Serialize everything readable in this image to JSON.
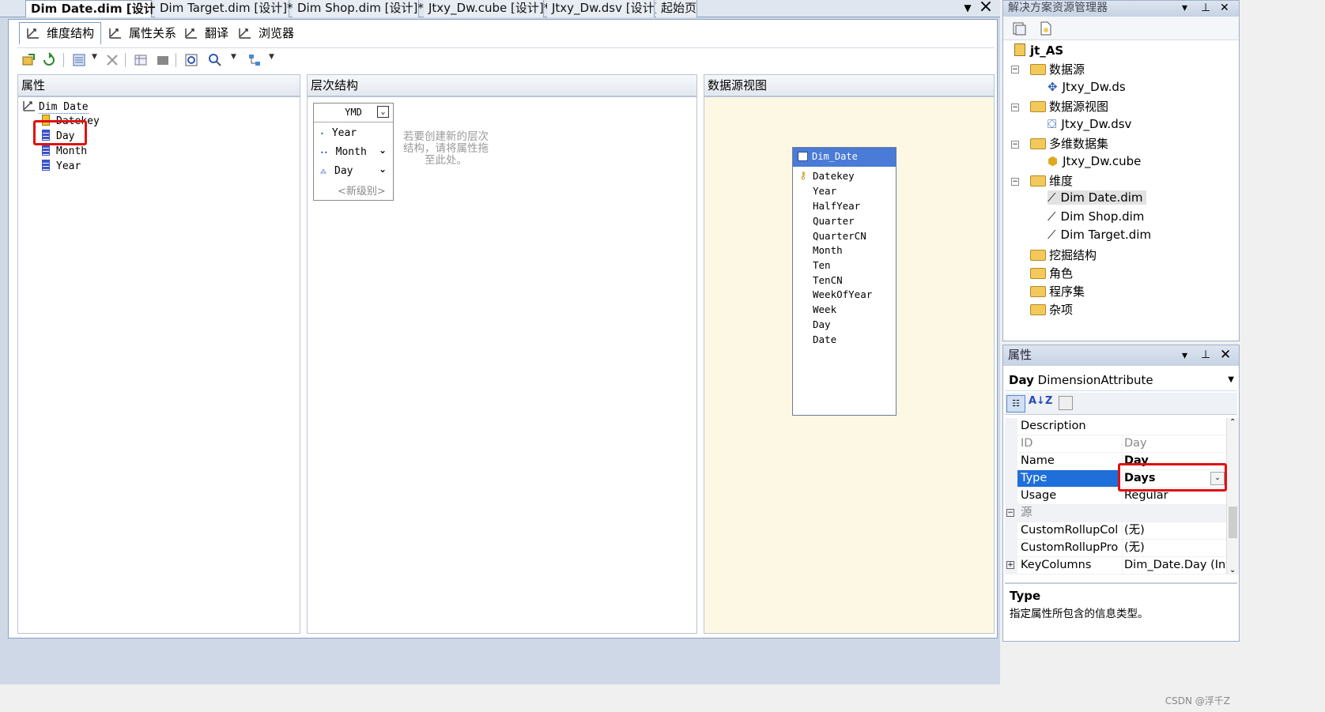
{
  "doc_tabs": [
    {
      "label": "Dim Date.dim [设计]*",
      "active": true
    },
    {
      "label": "Dim Target.dim [设计]*",
      "active": false
    },
    {
      "label": "Dim Shop.dim [设计]*",
      "active": false
    },
    {
      "label": "Jtxy_Dw.cube [设计]*",
      "active": false
    },
    {
      "label": "Jtxy_Dw.dsv [设计]",
      "active": false
    },
    {
      "label": "起始页",
      "active": false
    }
  ],
  "designer_tabs": [
    "维度结构",
    "属性关系",
    "翻译",
    "浏览器"
  ],
  "panes": {
    "attributes": {
      "header": "属性",
      "dimension": "Dim Date",
      "items": [
        "Datekey",
        "Day",
        "Month",
        "Year"
      ]
    },
    "hierarchies": {
      "header": "层次结构",
      "hierarchy": {
        "name": "YMD",
        "levels": [
          "Year",
          "Month",
          "Day"
        ],
        "new_level": "<新级别>"
      },
      "hint": "若要创建新的层次结构，请将属性拖至此处。"
    },
    "dsv": {
      "header": "数据源视图",
      "table": "Dim_Date",
      "columns": [
        "Datekey",
        "Year",
        "HalfYear",
        "Quarter",
        "QuarterCN",
        "Month",
        "Ten",
        "TenCN",
        "WeekOfYear",
        "Week",
        "Day",
        "Date"
      ]
    }
  },
  "solution_explorer": {
    "title": "解决方案资源管理器",
    "project": "jt_AS",
    "nodes": [
      {
        "label": "数据源",
        "children": [
          "Jtxy_Dw.ds"
        ]
      },
      {
        "label": "数据源视图",
        "children": [
          "Jtxy_Dw.dsv"
        ]
      },
      {
        "label": "多维数据集",
        "children": [
          "Jtxy_Dw.cube"
        ]
      },
      {
        "label": "维度",
        "children": [
          "Dim Date.dim",
          "Dim Shop.dim",
          "Dim Target.dim"
        ]
      },
      {
        "label": "挖掘结构",
        "children": []
      },
      {
        "label": "角色",
        "children": []
      },
      {
        "label": "程序集",
        "children": []
      },
      {
        "label": "杂项",
        "children": []
      }
    ]
  },
  "properties": {
    "title": "属性",
    "object_name": "Day",
    "object_type": "DimensionAttribute",
    "rows": [
      {
        "name": "Description",
        "value": ""
      },
      {
        "name": "ID",
        "value": "Day"
      },
      {
        "name": "Name",
        "value": "Day"
      },
      {
        "name": "Type",
        "value": "Days"
      },
      {
        "name": "Usage",
        "value": "Regular"
      },
      {
        "name": "源",
        "value": ""
      },
      {
        "name": "CustomRollupColu",
        "value": "(无)"
      },
      {
        "name": "CustomRollupProp",
        "value": "(无)"
      },
      {
        "name": "KeyColumns",
        "value": "Dim_Date.Day (Inte"
      }
    ],
    "desc_title": "Type",
    "desc_text": "指定属性所包含的信息类型。"
  },
  "watermark": "CSDN @浮千Z"
}
